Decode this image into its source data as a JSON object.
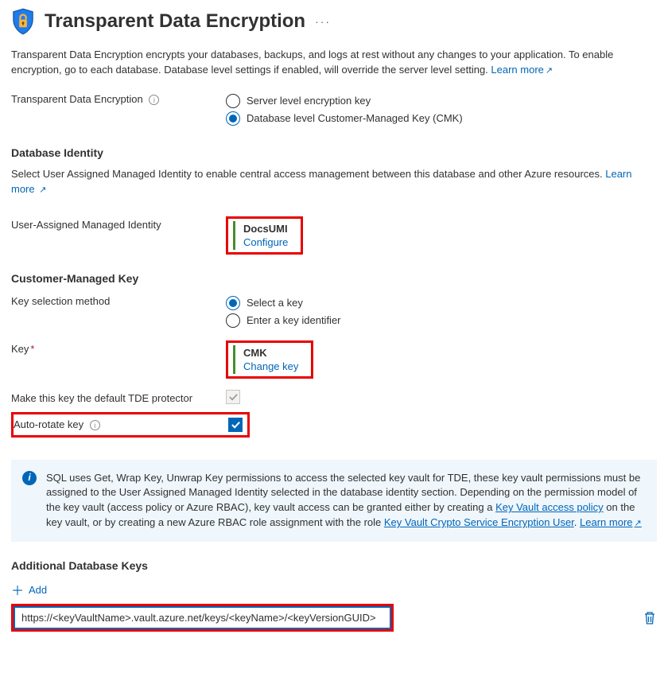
{
  "header": {
    "title": "Transparent Data Encryption"
  },
  "intro": {
    "text": "Transparent Data Encryption encrypts your databases, backups, and logs at rest without any changes to your application. To enable encryption, go to each database. Database level settings if enabled, will override the server level setting. ",
    "learn_more": "Learn more"
  },
  "tde": {
    "label": "Transparent Data Encryption",
    "opt_server": "Server level encryption key",
    "opt_db": "Database level Customer-Managed Key (CMK)"
  },
  "db_identity": {
    "heading": "Database Identity",
    "desc": "Select User Assigned Managed Identity to enable central access management between this database and other Azure resources. ",
    "learn_more": "Learn more",
    "uami_label": "User-Assigned Managed Identity",
    "uami_name": "DocsUMI",
    "uami_action": "Configure"
  },
  "cmk": {
    "heading": "Customer-Managed Key",
    "key_sel_label": "Key selection method",
    "opt_select": "Select a key",
    "opt_identifier": "Enter a key identifier",
    "key_label": "Key",
    "key_name": "CMK",
    "key_action": "Change key",
    "default_protector_label": "Make this key the default TDE protector",
    "auto_rotate_label": "Auto-rotate key"
  },
  "info_text": {
    "p1": "SQL uses Get, Wrap Key, Unwrap Key permissions to access the selected key vault for TDE, these key vault permissions must be assigned to the User Assigned Managed Identity selected in the database identity section. Depending on the permission model of the key vault (access policy or Azure RBAC), key vault access can be granted either by creating a ",
    "link1": "Key Vault access policy",
    "p2": " on the key vault, or by creating a new Azure RBAC role assignment with the role ",
    "link2": "Key Vault Crypto Service Encryption User",
    "p3": ". ",
    "learn_more": "Learn more"
  },
  "additional_keys": {
    "heading": "Additional Database Keys",
    "add_label": "Add",
    "input_value": "https://<keyVaultName>.vault.azure.net/keys/<keyName>/<keyVersionGUID>"
  }
}
